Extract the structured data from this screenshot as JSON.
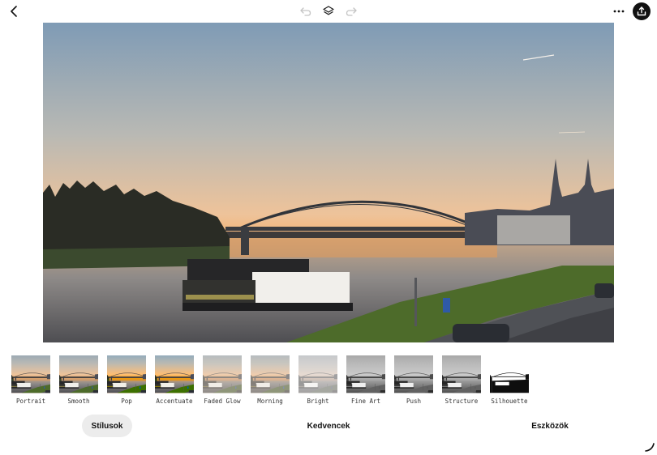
{
  "topbar": {
    "icons": [
      "back-arrow-icon",
      "undo-icon",
      "layers-icon",
      "redo-icon",
      "more-options-icon",
      "share-upload-icon"
    ]
  },
  "photo": {
    "description_icon": "photo-preview"
  },
  "filters": [
    {
      "label": "Portrait",
      "style": "normal"
    },
    {
      "label": "Smooth",
      "style": "normal"
    },
    {
      "label": "Pop",
      "style": "vivid"
    },
    {
      "label": "Accentuate",
      "style": "vivid"
    },
    {
      "label": "Faded Glow",
      "style": "faded"
    },
    {
      "label": "Morning",
      "style": "faded"
    },
    {
      "label": "Bright",
      "style": "bright"
    },
    {
      "label": "Fine Art",
      "style": "bw"
    },
    {
      "label": "Push",
      "style": "bw"
    },
    {
      "label": "Structure",
      "style": "bw"
    },
    {
      "label": "Silhouette",
      "style": "silhouette"
    }
  ],
  "tabs": {
    "styles": "Stílusok",
    "favorites": "Kedvencek",
    "tools": "Eszközök"
  },
  "colors": {
    "sky_top": "#7d98b3",
    "sky_mid": "#e9c7a0",
    "sky_horizon": "#f6a24a",
    "water": "#a9a6a2",
    "accent_active_tab": "#ececec"
  }
}
